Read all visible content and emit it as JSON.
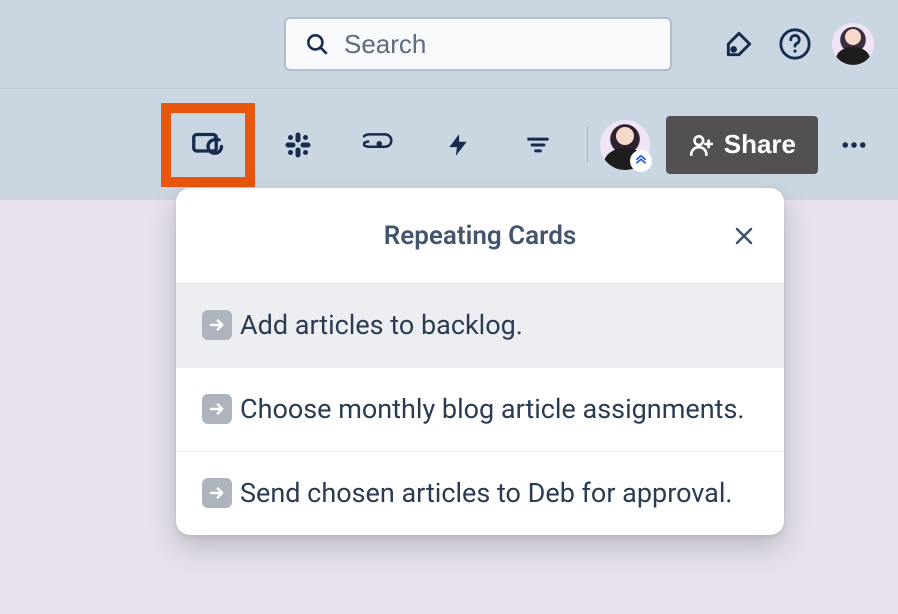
{
  "topbar": {
    "search_placeholder": "Search"
  },
  "boardbar": {
    "share_label": "Share"
  },
  "dropdown": {
    "title": "Repeating Cards",
    "items": [
      "Add articles to backlog.",
      "Choose monthly blog article assignments.",
      "Send chosen articles to Deb for approval."
    ]
  }
}
